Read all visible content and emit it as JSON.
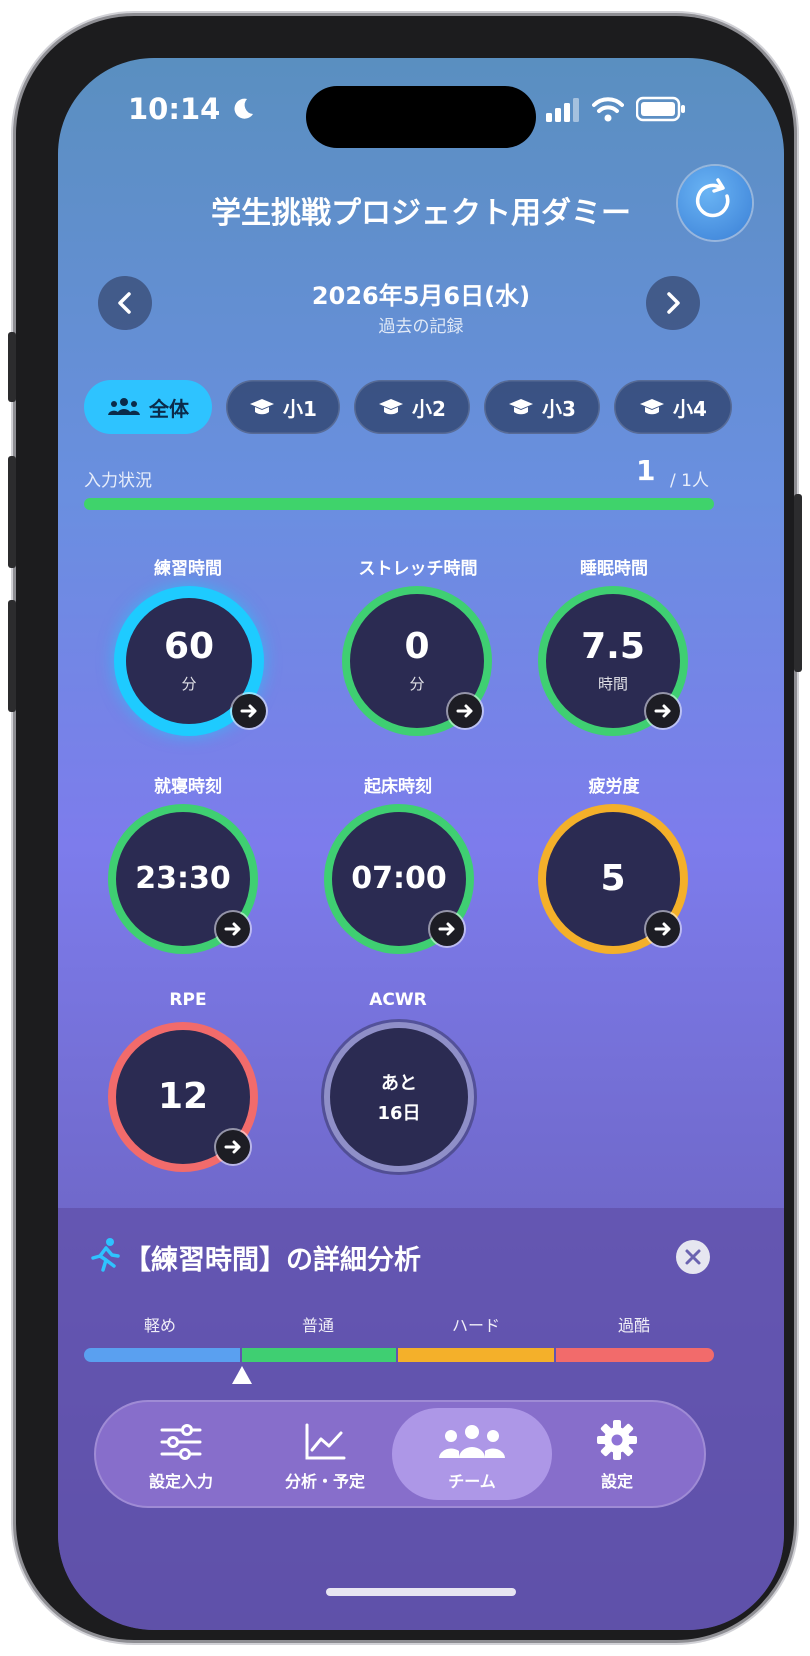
{
  "status_bar": {
    "time": "10:14"
  },
  "header": {
    "title": "学生挑戦プロジェクト用ダミー"
  },
  "date_nav": {
    "date": "2026年5月6日(水)",
    "subtitle": "過去の記録"
  },
  "group_tabs": [
    {
      "label": "全体",
      "active": true
    },
    {
      "label": "小1",
      "active": false
    },
    {
      "label": "小2",
      "active": false
    },
    {
      "label": "小3",
      "active": false
    },
    {
      "label": "小4",
      "active": false
    }
  ],
  "input_status": {
    "label": "入力状況",
    "count": "1",
    "total": "/ 1人",
    "progress": 1.0
  },
  "metrics": [
    {
      "label": "練習時間",
      "value": "60",
      "unit": "分",
      "color": "#1ecbff"
    },
    {
      "label": "ストレッチ時間",
      "value": "0",
      "unit": "分",
      "color": "#3fcf72"
    },
    {
      "label": "睡眠時間",
      "value": "7.5",
      "unit": "時間",
      "color": "#3fcf72"
    },
    {
      "label": "就寝時刻",
      "value": "23:30",
      "unit": "",
      "color": "#3fcf72"
    },
    {
      "label": "起床時刻",
      "value": "07:00",
      "unit": "",
      "color": "#3fcf72"
    },
    {
      "label": "疲労度",
      "value": "5",
      "unit": "",
      "color": "#f4b02a"
    },
    {
      "label": "RPE",
      "value": "12",
      "unit": "",
      "color": "#f26b6b"
    },
    {
      "label": "ACWR",
      "value": "あと",
      "unit": "16日",
      "color": "#8f8fc8"
    }
  ],
  "detail": {
    "title": "【練習時間】の詳細分析",
    "levels": [
      {
        "label": "軽め",
        "color": "#5aa0f0"
      },
      {
        "label": "普通",
        "color": "#3fcf72"
      },
      {
        "label": "ハード",
        "color": "#f4b02a"
      },
      {
        "label": "過酷",
        "color": "#f26b6b"
      }
    ]
  },
  "tab_bar": [
    {
      "label": "設定入力",
      "icon": "sliders-icon"
    },
    {
      "label": "分析・予定",
      "icon": "chart-line-icon"
    },
    {
      "label": "チーム",
      "icon": "team-icon",
      "active": true
    },
    {
      "label": "設定",
      "icon": "gear-icon"
    }
  ]
}
